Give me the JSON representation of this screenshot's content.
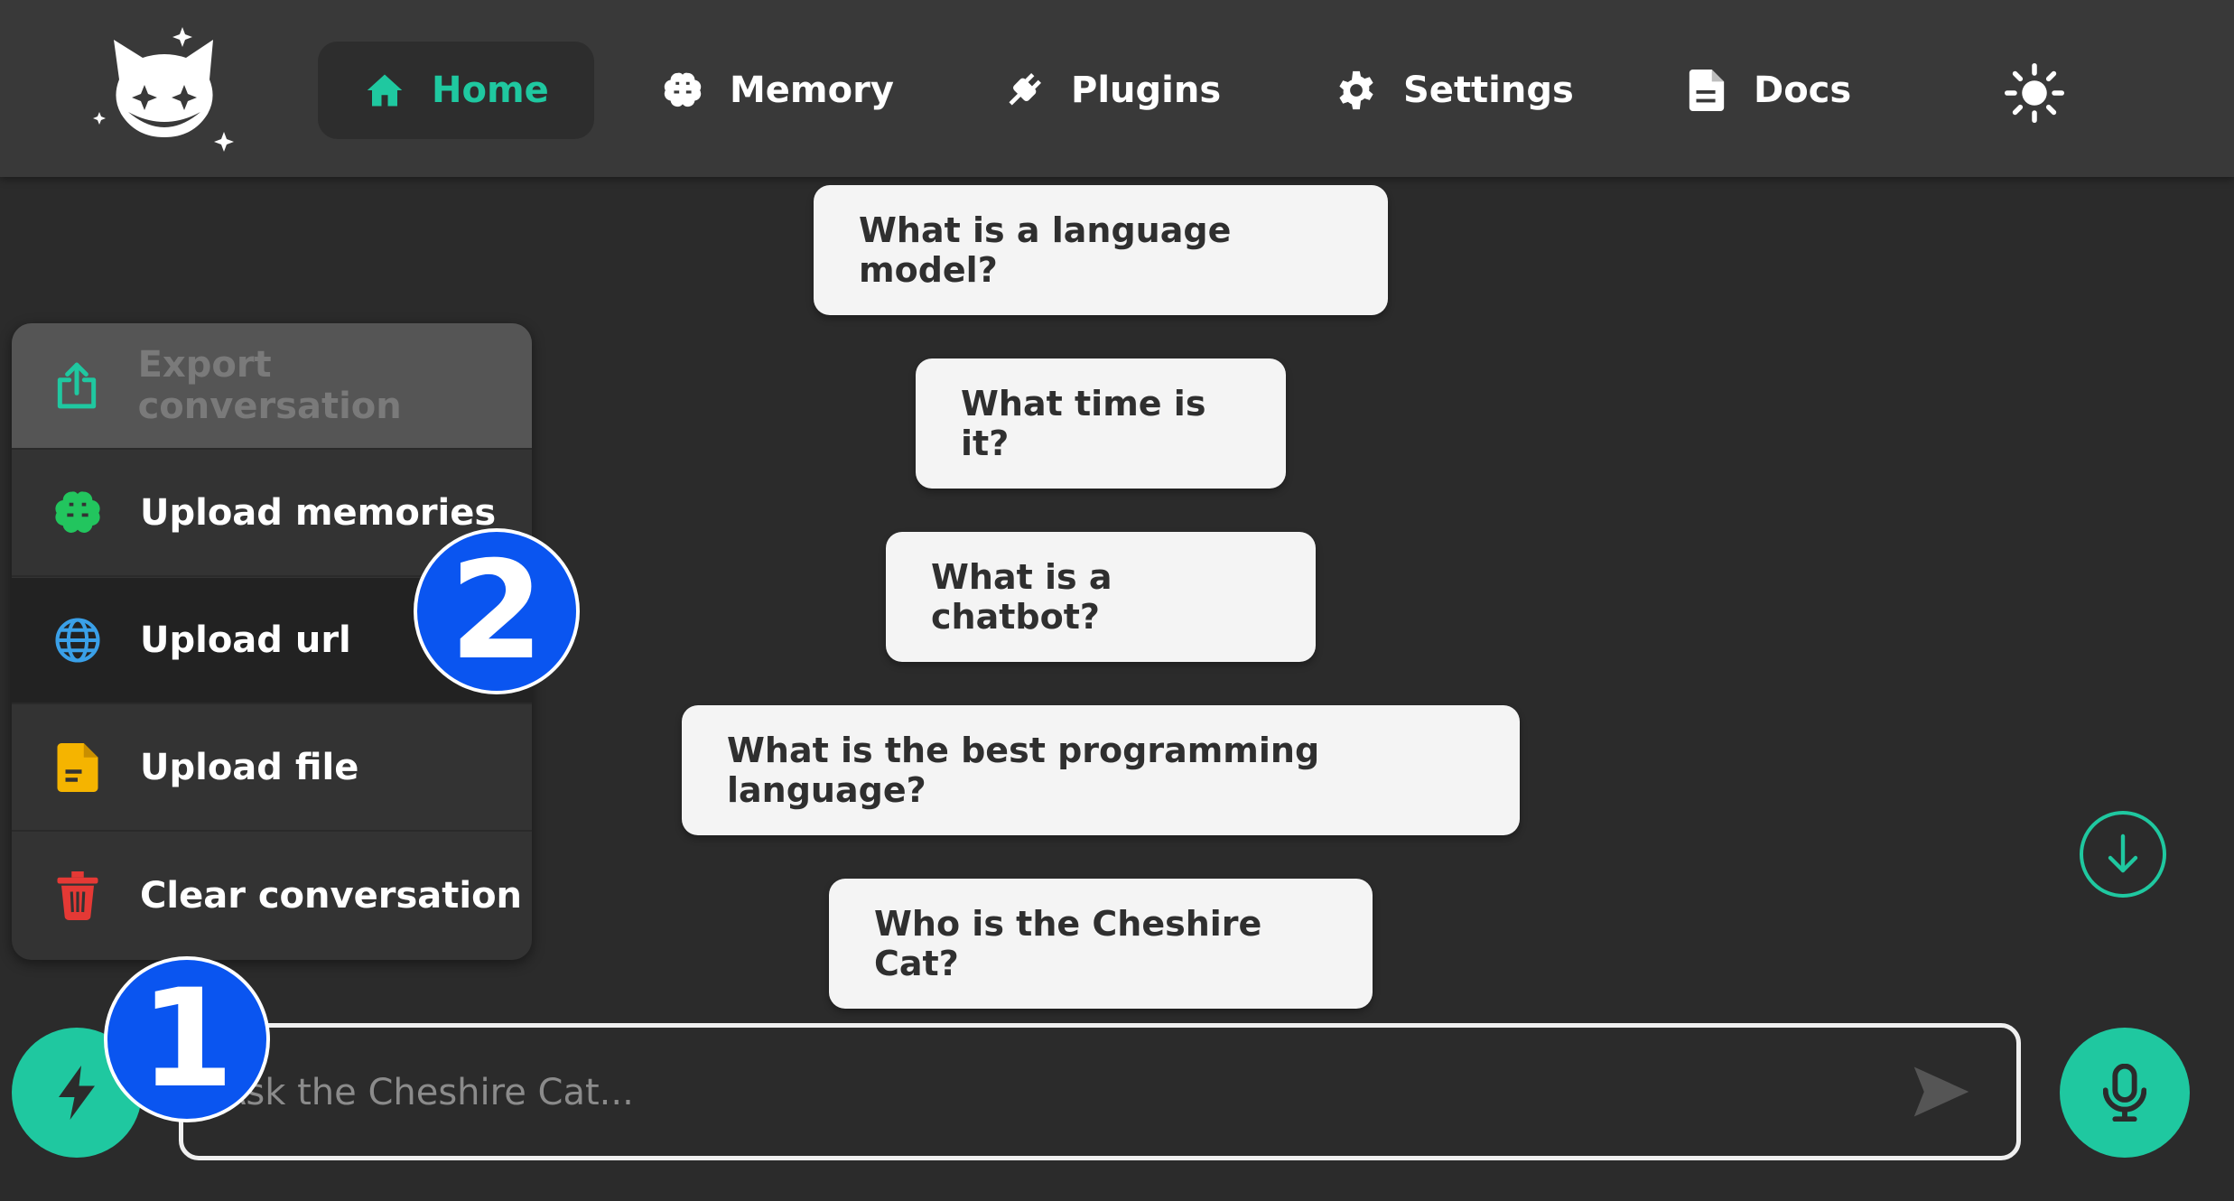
{
  "nav": {
    "items": [
      {
        "label": "Home",
        "icon": "home-icon",
        "active": true
      },
      {
        "label": "Memory",
        "icon": "brain-icon"
      },
      {
        "label": "Plugins",
        "icon": "plug-icon"
      },
      {
        "label": "Settings",
        "icon": "gear-icon"
      },
      {
        "label": "Docs",
        "icon": "document-icon"
      }
    ],
    "theme_icon": "sun-icon"
  },
  "suggestions": [
    "What is a language model?",
    "What time is it?",
    "What is a chatbot?",
    "What is the best programming language?",
    "Who is the Cheshire Cat?"
  ],
  "menu": {
    "items": [
      {
        "label": "Export conversation",
        "icon": "export-icon",
        "disabled": true
      },
      {
        "label": "Upload memories",
        "icon": "brain-icon"
      },
      {
        "label": "Upload url",
        "icon": "globe-icon",
        "hovered": true
      },
      {
        "label": "Upload file",
        "icon": "file-icon"
      },
      {
        "label": "Clear conversation",
        "icon": "trash-icon"
      }
    ]
  },
  "markers": [
    "1",
    "2"
  ],
  "input": {
    "placeholder": "Ask the Cheshire Cat..."
  },
  "colors": {
    "accent": "#1fc8a0",
    "marker": "#0a55f0",
    "danger": "#e53935",
    "file": "#f5b400",
    "globe": "#3aa0e8",
    "memory": "#22c55e"
  }
}
